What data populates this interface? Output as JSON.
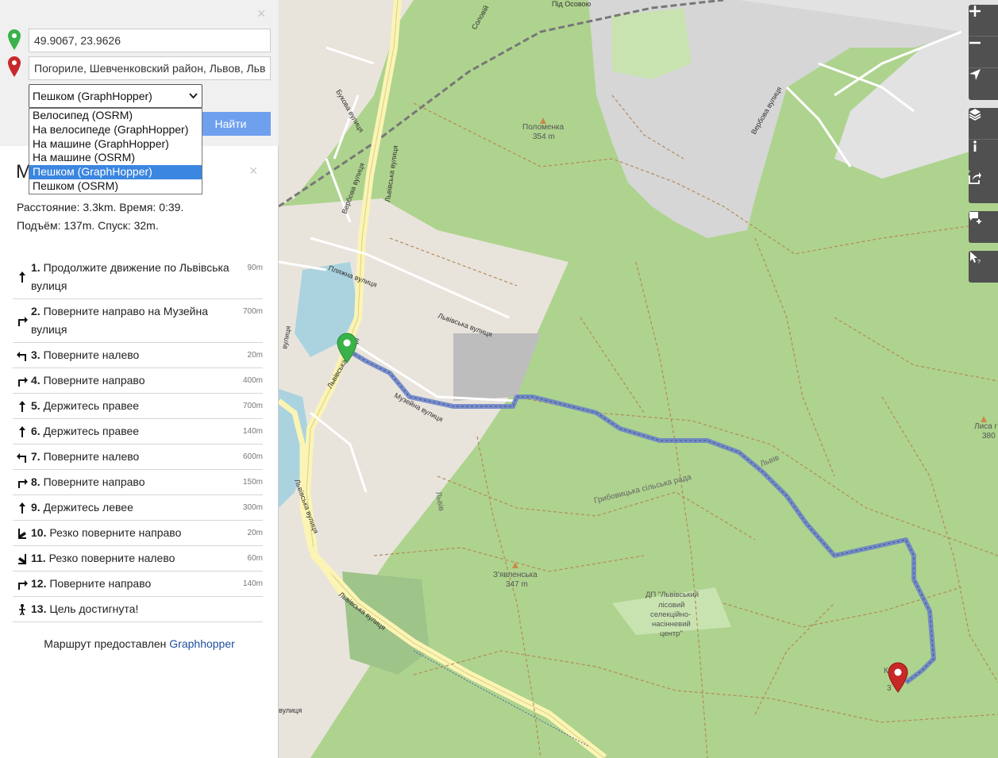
{
  "search": {
    "from_value": "49.9067, 23.9626",
    "to_value": "Погориле, Шевченковский район, Львов, Львовская область",
    "mode_selected": "Пешком (GraphHopper)",
    "mode_options": [
      "Велосипед (OSRM)",
      "На велосипеде (GraphHopper)",
      "На машине (GraphHopper)",
      "На машине (OSRM)",
      "Пешком (GraphHopper)",
      "Пешком (OSRM)"
    ],
    "find_label": "Найти"
  },
  "route": {
    "title": "M",
    "summary_line1": "Расстояние: 3.3km. Время: 0:39.",
    "summary_line2": "Подъём: 137m. Спуск: 32m.",
    "steps": [
      {
        "num": "1.",
        "text": "Продолжите движение по Львівська вулиця",
        "dist": "90m",
        "icon": "straight-arrow-icon"
      },
      {
        "num": "2.",
        "text": "Поверните направо на Музейна вулиця",
        "dist": "700m",
        "icon": "turn-right-icon"
      },
      {
        "num": "3.",
        "text": "Поверните налево",
        "dist": "20m",
        "icon": "turn-left-icon"
      },
      {
        "num": "4.",
        "text": "Поверните направо",
        "dist": "400m",
        "icon": "turn-right-icon"
      },
      {
        "num": "5.",
        "text": "Держитесь правее",
        "dist": "700m",
        "icon": "straight-arrow-icon"
      },
      {
        "num": "6.",
        "text": "Держитесь правее",
        "dist": "140m",
        "icon": "straight-arrow-icon"
      },
      {
        "num": "7.",
        "text": "Поверните налево",
        "dist": "600m",
        "icon": "turn-left-icon"
      },
      {
        "num": "8.",
        "text": "Поверните направо",
        "dist": "150m",
        "icon": "turn-right-icon"
      },
      {
        "num": "9.",
        "text": "Держитесь левее",
        "dist": "300m",
        "icon": "straight-arrow-icon"
      },
      {
        "num": "10.",
        "text": "Резко поверните направо",
        "dist": "20m",
        "icon": "sharp-right-icon"
      },
      {
        "num": "11.",
        "text": "Резко поверните налево",
        "dist": "60m",
        "icon": "sharp-left-icon"
      },
      {
        "num": "12.",
        "text": "Поверните направо",
        "dist": "140m",
        "icon": "turn-right-icon"
      },
      {
        "num": "13.",
        "text": "Цель достигнута!",
        "dist": "",
        "icon": "destination-icon"
      }
    ]
  },
  "attribution": {
    "prefix": "Маршрут предоставлен",
    "link": "Graphhopper"
  },
  "map": {
    "labels": {
      "polomenka": "Поломенка",
      "polomenka_ele": "354 m",
      "zyavlenska": "З'явленська",
      "zyavlenska_ele": "347 m",
      "lysa": "Лиса г",
      "lysa_ele": "380",
      "k_hill": "К",
      "k_hill_ele": "3",
      "lvivska_1": "Львівська вулиця",
      "lvivska_2": "Львівська вулиця",
      "lvivska_3": "Львівська вулиця",
      "lvivska_4": "Львівська вулиця",
      "lvivska_5": "Львівська вулиця",
      "muzeina": "Музейна вулиця",
      "vyshneva": "Вербова вулиця",
      "bukova": "Букова вулиця",
      "pliazhna": "Пляжна вулиця",
      "verbova": "Вербова вулиця",
      "pid_osov": "Під Осовою",
      "slovyk": "Соловій",
      "council": "Грибовицька сільська рада",
      "lviv_1": "Львів",
      "lviv_2": "Львів",
      "forest_1": "ДП \"Львівський",
      "forest_2": "лісовий",
      "forest_3": "селекційно-",
      "forest_4": "насінневий",
      "forest_5": "центр\"",
      "street_a": "вулиця",
      "street_b": "вулиця"
    }
  },
  "colors": {
    "accent": "#6ea0ee",
    "selected": "#3b86e0",
    "route": "#6d84c8",
    "start_marker": "#3ab24a",
    "end_marker": "#c82828"
  }
}
